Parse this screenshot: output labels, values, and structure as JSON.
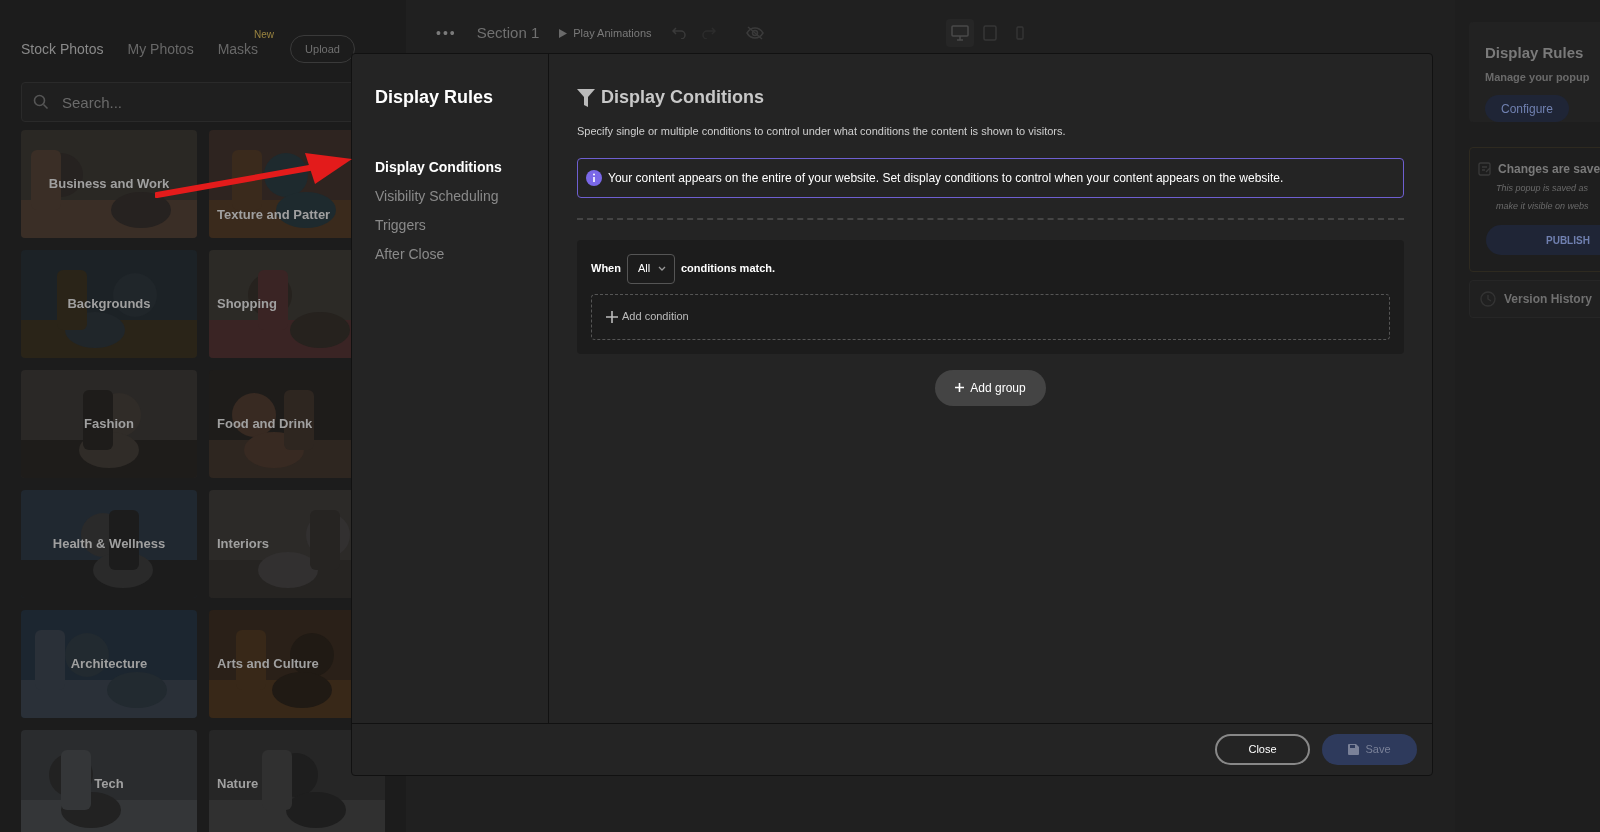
{
  "left_panel": {
    "tabs": [
      {
        "label": "Stock Photos",
        "selected": true
      },
      {
        "label": "My Photos",
        "selected": false
      },
      {
        "label": "Masks",
        "selected": false,
        "badge": "New"
      }
    ],
    "upload": "Upload",
    "search": {
      "placeholder": "Search..."
    },
    "categories": [
      {
        "label": "Business and Work"
      },
      {
        "label": "Texture and Patter"
      },
      {
        "label": "Backgrounds"
      },
      {
        "label": "Shopping"
      },
      {
        "label": "Fashion"
      },
      {
        "label": "Food and Drink"
      },
      {
        "label": "Health & Wellness"
      },
      {
        "label": "Interiors"
      },
      {
        "label": "Architecture"
      },
      {
        "label": "Arts and Culture"
      },
      {
        "label": "Tech"
      },
      {
        "label": "Nature"
      }
    ]
  },
  "toolbar": {
    "menu": "•••",
    "section": "Section 1",
    "play": "Play Animations",
    "devices": [
      {
        "kind": "desktop",
        "selected": true
      },
      {
        "kind": "tablet",
        "selected": false
      },
      {
        "kind": "mobile",
        "selected": false
      }
    ]
  },
  "right_panel": {
    "title": "Display Rules",
    "subtitle": "Manage your popup",
    "configure": "Configure",
    "status_card": {
      "title": "Changes are save",
      "lines": [
        "This popup is saved as",
        "make it visible on webs"
      ],
      "button": "PUBLISH"
    },
    "version_history": "Version History"
  },
  "modal": {
    "title": "Display Rules",
    "nav": [
      {
        "label": "Display Conditions",
        "selected": true
      },
      {
        "label": "Visibility Scheduling",
        "selected": false
      },
      {
        "label": "Triggers",
        "selected": false
      },
      {
        "label": "After Close",
        "selected": false
      }
    ],
    "heading": "Display Conditions",
    "description": "Specify single or multiple conditions to control under what conditions the content is shown to visitors.",
    "notice": "Your content appears on the entire of your website. Set display conditions to control when your content appears on the website.",
    "group": {
      "when": "When",
      "match": "All",
      "suffix": "conditions match.",
      "add_condition": "Add condition"
    },
    "add_group": "Add group",
    "buttons": [
      {
        "label": "Close",
        "kind": "secondary",
        "disabled": false
      },
      {
        "label": "Save",
        "kind": "primary",
        "disabled": true
      }
    ]
  }
}
